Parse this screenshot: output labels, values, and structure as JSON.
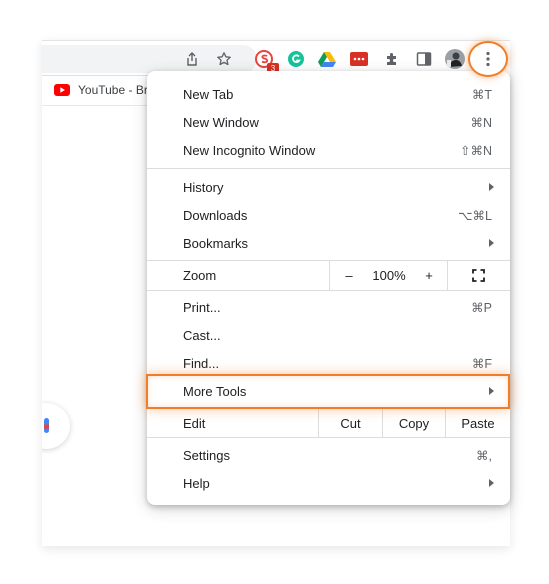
{
  "toolbar": {
    "extension_badge": "3"
  },
  "bookmarks": {
    "item": "YouTube - Br"
  },
  "menu": {
    "new_tab": {
      "label": "New Tab",
      "shortcut": "⌘T"
    },
    "new_window": {
      "label": "New Window",
      "shortcut": "⌘N"
    },
    "new_incognito": {
      "label": "New Incognito Window",
      "shortcut": "⇧⌘N"
    },
    "history": {
      "label": "History"
    },
    "downloads": {
      "label": "Downloads",
      "shortcut": "⌥⌘L"
    },
    "bookmarks": {
      "label": "Bookmarks"
    },
    "zoom": {
      "label": "Zoom",
      "minus": "–",
      "level": "100%",
      "plus": "+"
    },
    "print": {
      "label": "Print...",
      "shortcut": "⌘P"
    },
    "cast": {
      "label": "Cast..."
    },
    "find": {
      "label": "Find...",
      "shortcut": "⌘F"
    },
    "more_tools": {
      "label": "More Tools"
    },
    "edit": {
      "label": "Edit",
      "cut": "Cut",
      "copy": "Copy",
      "paste": "Paste"
    },
    "settings": {
      "label": "Settings",
      "shortcut": "⌘,"
    },
    "help": {
      "label": "Help"
    }
  },
  "colors": {
    "highlight": "#f07d2a",
    "badge": "#d93025"
  }
}
